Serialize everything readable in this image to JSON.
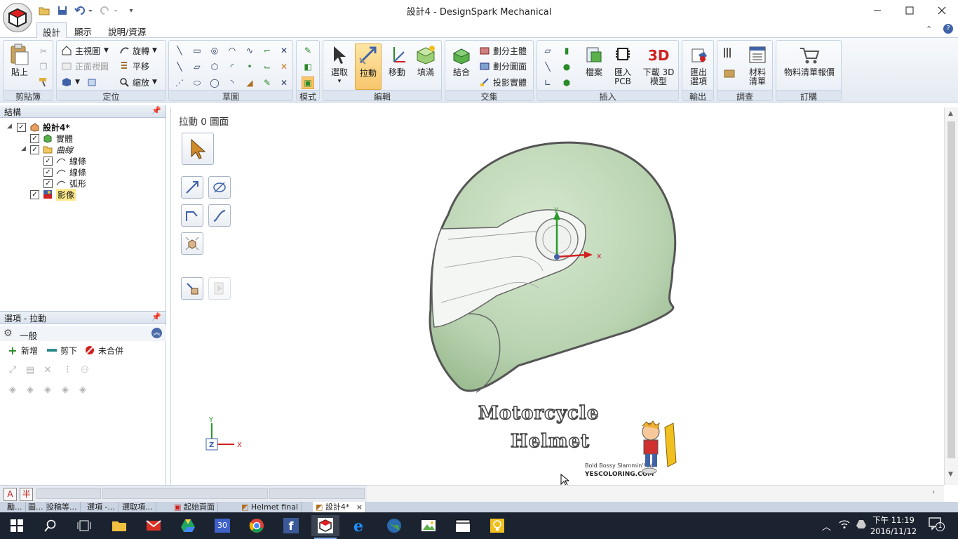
{
  "window": {
    "title": "設計4 - DesignSpark Mechanical"
  },
  "ribbon_tabs": [
    "設計",
    "顯示",
    "說明/資源"
  ],
  "groups": {
    "clipboard": {
      "label": "剪貼簿",
      "paste": "貼上"
    },
    "orient": {
      "label": "定位",
      "home_view": "主視圖",
      "front_view": "正面視圖",
      "rotate": "旋轉",
      "pan": "平移",
      "zoom": "縮放"
    },
    "sketch": {
      "label": "草圖"
    },
    "mode": {
      "label": "模式"
    },
    "edit": {
      "label": "編輯",
      "select": "選取",
      "pull": "拉動",
      "move": "移動",
      "fill": "填滿"
    },
    "intersect": {
      "label": "交集",
      "combine": "結合",
      "split_body": "劃分主體",
      "split_face": "劃分圖面",
      "project_body": "投影實體"
    },
    "insert": {
      "label": "插入",
      "file": "檔案",
      "import_pcb_1": "匯入",
      "import_pcb_2": "PCB",
      "download_3d_1": "下載 3D",
      "download_3d_2": "模型"
    },
    "output": {
      "label": "輸出",
      "export_1": "匯出",
      "export_2": "選項"
    },
    "investigate": {
      "label": "調查",
      "bom_1": "材料",
      "bom_2": "清單"
    },
    "order": {
      "label": "訂購",
      "bom_quote": "物料清單報價"
    }
  },
  "structure_panel": {
    "title": "結構",
    "tree": {
      "root": "設計4*",
      "solid": "實體",
      "curves": "曲線",
      "line1": "線條",
      "line2": "線條",
      "arc": "弧形",
      "image": "影像"
    }
  },
  "options_panel": {
    "title": "選項 - 拉動",
    "section": "一般",
    "add": "新增",
    "cut": "剪下",
    "no_merge": "未合併"
  },
  "canvas": {
    "status": "拉動 0 圖面",
    "image_title_1": "Motorcycle",
    "image_title_2": "Helmet",
    "image_caption_1": "Bold Bossy Slammin'! At",
    "image_caption_2": "YESCOLORING.COM",
    "triad_x": "X",
    "triad_y": "Y",
    "triad_z": "Z",
    "axis_x": "x",
    "axis_y": "y"
  },
  "bottom_left": {
    "ime_a": "A",
    "ime_half": "半"
  },
  "doc_tabs": [
    "勵...",
    "圖...",
    "投稿等...",
    "選項 -...",
    "選取項...",
    "起始頁面",
    "Helmet final",
    "設計4*"
  ],
  "taskbar": {
    "time": "下午 11:19",
    "date": "2016/11/12",
    "calendar_day": "30",
    "notifications": "1"
  },
  "colors": {
    "accent": "#3c6cb4",
    "helmet": "#b9d3b1",
    "taskbar": "#1c2330"
  }
}
